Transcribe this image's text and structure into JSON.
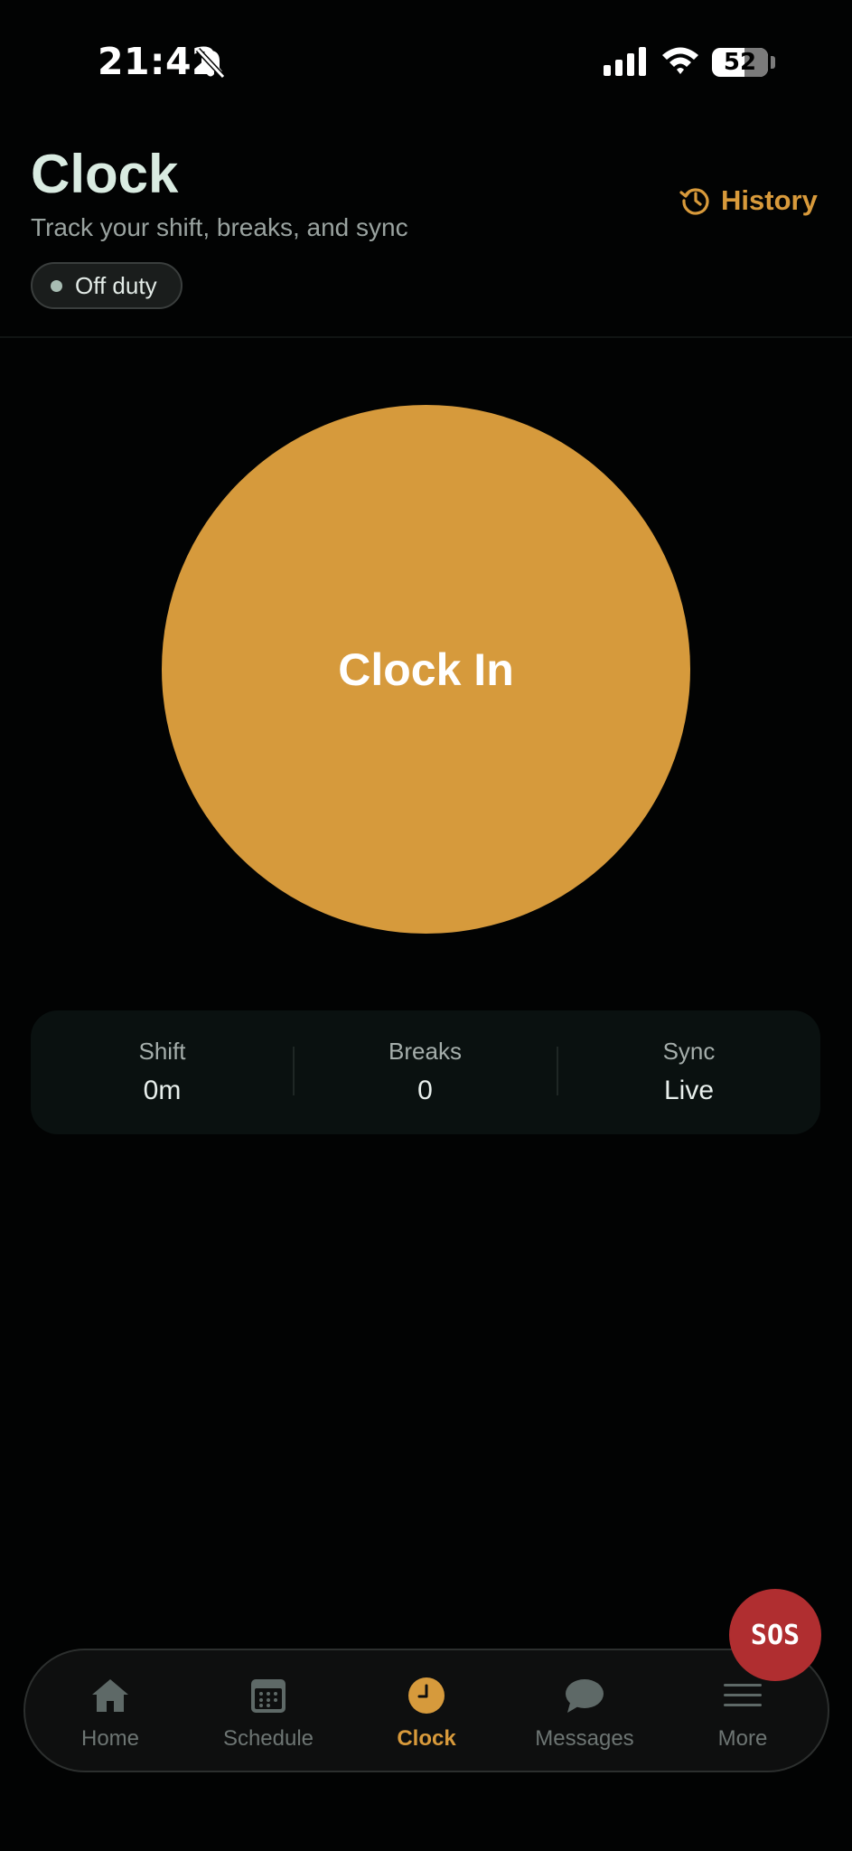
{
  "status_bar": {
    "time": "21:42",
    "battery": "52"
  },
  "header": {
    "title": "Clock",
    "subtitle": "Track your shift, breaks, and sync",
    "status_pill": "Off duty",
    "history_label": "History"
  },
  "clock_button": {
    "label": "Clock In"
  },
  "stats": [
    {
      "label": "Shift",
      "value": "0m"
    },
    {
      "label": "Breaks",
      "value": "0"
    },
    {
      "label": "Sync",
      "value": "Live"
    }
  ],
  "sos": {
    "label": "SOS"
  },
  "nav": {
    "items": [
      {
        "label": "Home",
        "icon": "home-icon"
      },
      {
        "label": "Schedule",
        "icon": "calendar-icon"
      },
      {
        "label": "Clock",
        "icon": "clock-icon",
        "active": true
      },
      {
        "label": "Messages",
        "icon": "chat-bubble-icon"
      },
      {
        "label": "More",
        "icon": "menu-icon"
      }
    ]
  },
  "colors": {
    "accent": "#d69a3c",
    "background": "#020303",
    "sos": "#b02e30",
    "title": "#d9ebe1",
    "nav_inactive": "#6d7573"
  }
}
